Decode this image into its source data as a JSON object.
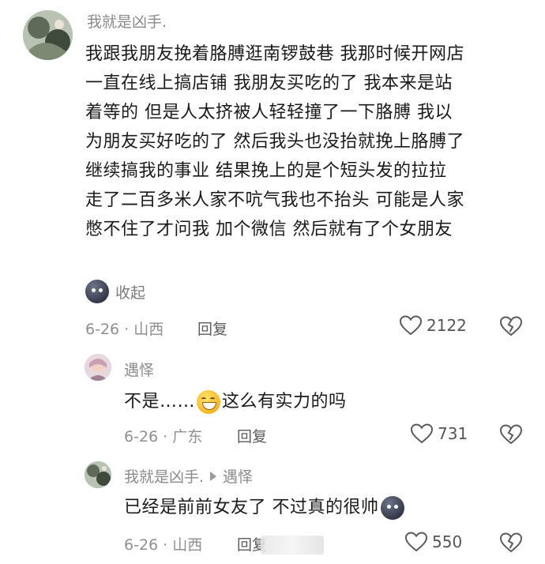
{
  "comment1": {
    "username": "我就是凶手.",
    "lines": [
      "我跟我朋友挽着胳膊逛南锣鼓巷 我那时候开网店",
      "一直在线上搞店铺 我朋友买吃的了 我本来是站",
      "着等的 但是人太挤被人轻轻撞了一下胳膊 我以",
      "为朋友买好吃的了 然后我头也没抬就挽上胳膊了",
      "继续搞我的事业 结果挽上的是个短头发的拉拉",
      "走了二百多米人家不吭气我也不抬头 可能是人家",
      "憋不住了才问我 加个微信 然后就有了个女朋友"
    ],
    "collapse_label": "收起",
    "date_location": "6-26 · 山西",
    "reply_label": "回复",
    "like_count": "2122"
  },
  "reply1": {
    "username": "遇怿",
    "text_before": "不是……",
    "text_after": "这么有实力的吗",
    "date_location": "6-26 · 广东",
    "reply_label": "回复",
    "like_count": "731"
  },
  "reply2": {
    "username": "我就是凶手.",
    "reply_to": "遇怿",
    "text": "已经是前前女友了 不过真的很帅",
    "date_location": "6-26 · 山西",
    "reply_label": "回复",
    "like_count": "550"
  },
  "icons": {
    "like": "heart-outline-icon",
    "dislike": "broken-heart-icon",
    "emoji_moon": "dark-moon-face-emoji",
    "emoji_smile": "grinning-sweat-emoji"
  }
}
